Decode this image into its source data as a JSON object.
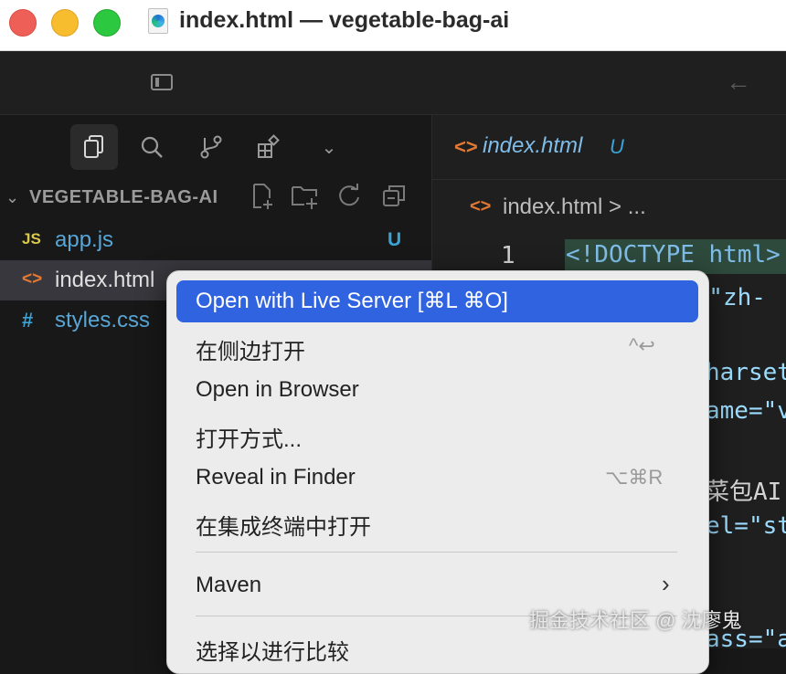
{
  "window": {
    "title": "index.html — vegetable-bag-ai",
    "traffic_lights": {
      "close": "#ee5f57",
      "minimize": "#f7bd2e",
      "zoom": "#2bc840"
    }
  },
  "activity_bar": {
    "items": [
      {
        "name": "explorer-icon",
        "glyph": "⧉"
      },
      {
        "name": "search-icon",
        "glyph": "⌕"
      },
      {
        "name": "source-control-icon",
        "glyph": "⑂"
      },
      {
        "name": "extensions-icon",
        "glyph": "⊞"
      },
      {
        "name": "more-icon",
        "glyph": "⌄"
      }
    ]
  },
  "explorer": {
    "title": "VEGETABLE-BAG-AI",
    "files": [
      {
        "icon": "JS",
        "icon_color": "#d9c84a",
        "name": "app.js",
        "status": "U"
      },
      {
        "icon": "<>",
        "icon_color": "#e37933",
        "name": "index.html",
        "status": ""
      },
      {
        "icon": "#",
        "icon_color": "#3aa2d4",
        "name": "styles.css",
        "status": ""
      }
    ]
  },
  "editor": {
    "tab": {
      "label": "index.html",
      "status": "U"
    },
    "breadcrumb": "index.html > ...",
    "line_number": "1",
    "code_fragments": {
      "line1": "<!DOCTYPE html>",
      "lang": "g=\"zh-",
      "charset": "harset",
      "name": "ame=\"v",
      "title": "菜包AI",
      "rel": "el=\"st",
      "class": "ass=\"a"
    }
  },
  "context_menu": {
    "highlighted": "Open with Live Server [⌘L ⌘O]",
    "items": [
      {
        "label": "在侧边打开",
        "shortcut": "^↩"
      },
      {
        "label": "Open in Browser",
        "shortcut": ""
      },
      {
        "label": "打开方式...",
        "shortcut": ""
      },
      {
        "label": "Reveal in Finder",
        "shortcut": "⌥⌘R"
      },
      {
        "label": "在集成终端中打开",
        "shortcut": ""
      }
    ],
    "maven": "Maven",
    "bottom_item": "选择以进行比较"
  },
  "watermark": "掘金技术社区 @ 沈廖鬼"
}
